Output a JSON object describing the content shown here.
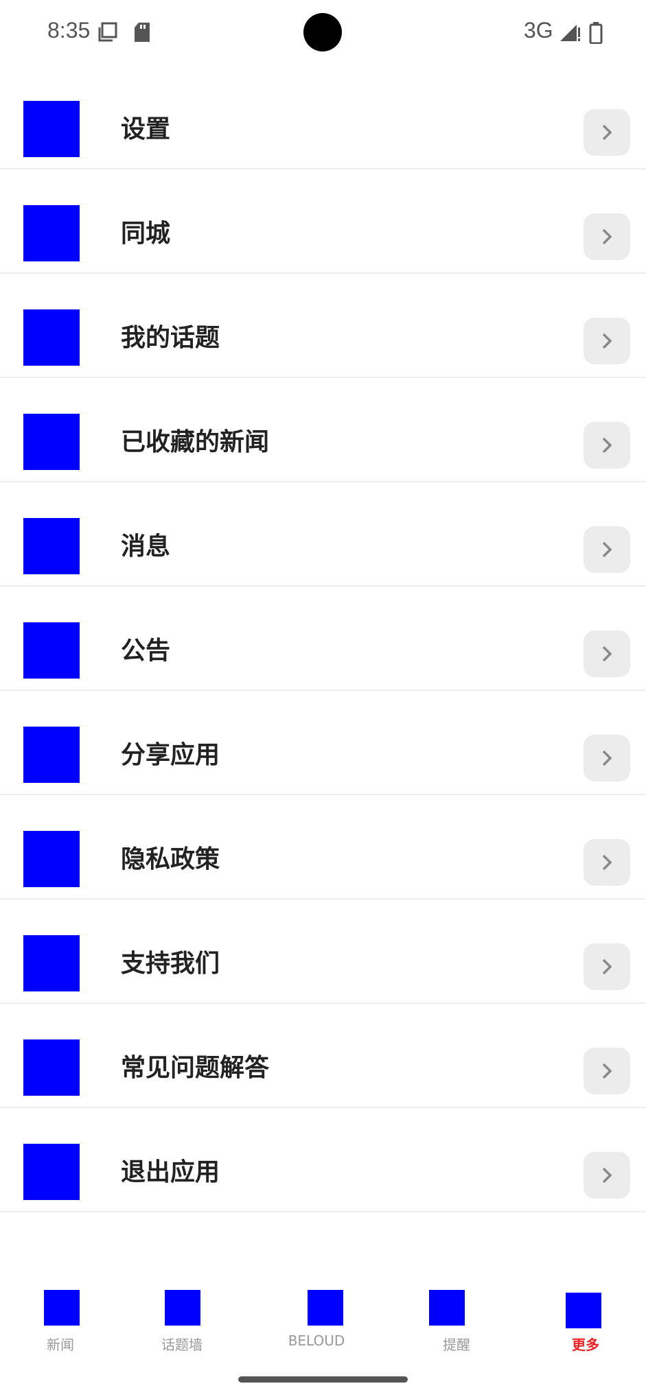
{
  "status_bar": {
    "time": "8:35",
    "network": "3G",
    "icons": [
      "screenshot-icon",
      "sd-card-icon",
      "signal-icon",
      "battery-icon"
    ]
  },
  "menu": {
    "items": [
      {
        "label": "设置",
        "icon": "settings-icon"
      },
      {
        "label": "同城",
        "icon": "city-icon"
      },
      {
        "label": "我的话题",
        "icon": "my-topics-icon"
      },
      {
        "label": "已收藏的新闻",
        "icon": "saved-news-icon"
      },
      {
        "label": "消息",
        "icon": "messages-icon"
      },
      {
        "label": "公告",
        "icon": "announcement-icon"
      },
      {
        "label": "分享应用",
        "icon": "share-icon"
      },
      {
        "label": "隐私政策",
        "icon": "privacy-icon"
      },
      {
        "label": "支持我们",
        "icon": "support-icon"
      },
      {
        "label": "常见问题解答",
        "icon": "faq-icon"
      },
      {
        "label": "退出应用",
        "icon": "exit-icon"
      }
    ]
  },
  "bottom_nav": {
    "items": [
      {
        "label": "新闻"
      },
      {
        "label": "话题墙"
      },
      {
        "label": "BELOUD"
      },
      {
        "label": "提醒"
      },
      {
        "label": "更多"
      }
    ],
    "active": "更多"
  },
  "colors": {
    "icon_placeholder": "#0000ff",
    "active_tab": "#ee2222",
    "arrow_bg": "#ececec"
  }
}
